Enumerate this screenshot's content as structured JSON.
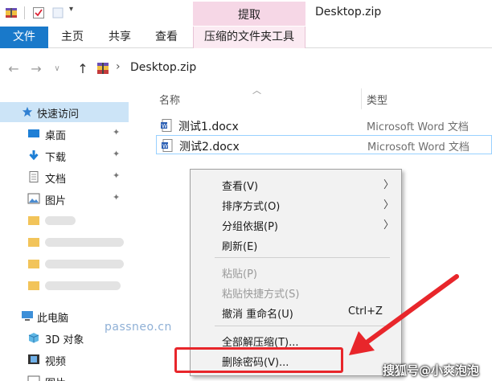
{
  "window": {
    "title": "Desktop.zip",
    "context_group": "提取"
  },
  "ribbon": {
    "tabs": [
      "文件",
      "主页",
      "共享",
      "查看"
    ],
    "context_tab": "压缩的文件夹工具"
  },
  "address": {
    "path": "Desktop.zip"
  },
  "nav": {
    "quick_access": "快速访问",
    "items": [
      "桌面",
      "下载",
      "文档",
      "图片"
    ],
    "pin_glyph": "📌",
    "this_pc": "此电脑",
    "pc_items": [
      "3D 对象",
      "视频",
      "图片"
    ]
  },
  "filelist": {
    "columns": {
      "name": "名称",
      "type": "类型"
    },
    "rows": [
      {
        "name": "测试1.docx",
        "type": "Microsoft Word 文档"
      },
      {
        "name": "测试2.docx",
        "type": "Microsoft Word 文档"
      }
    ]
  },
  "menu": {
    "items": [
      {
        "label": "查看(V)"
      },
      {
        "label": "排序方式(O)"
      },
      {
        "label": "分组依据(P)"
      },
      {
        "label": "刷新(E)"
      },
      {
        "label": "粘贴(P)"
      },
      {
        "label": "粘贴快捷方式(S)"
      },
      {
        "label": "撤消 重命名(U)",
        "shortcut": "Ctrl+Z"
      },
      {
        "label": "全部解压缩(T)..."
      },
      {
        "label": "删除密码(V)..."
      }
    ]
  },
  "watermarks": {
    "site": "passneo.cn",
    "author": "搜狐号@小爽泡泡"
  },
  "colors": {
    "file_tab": "#1979ca",
    "context_tab": "#f6d7e6",
    "selection": "#cce4f7",
    "annotation": "#e8262b"
  }
}
